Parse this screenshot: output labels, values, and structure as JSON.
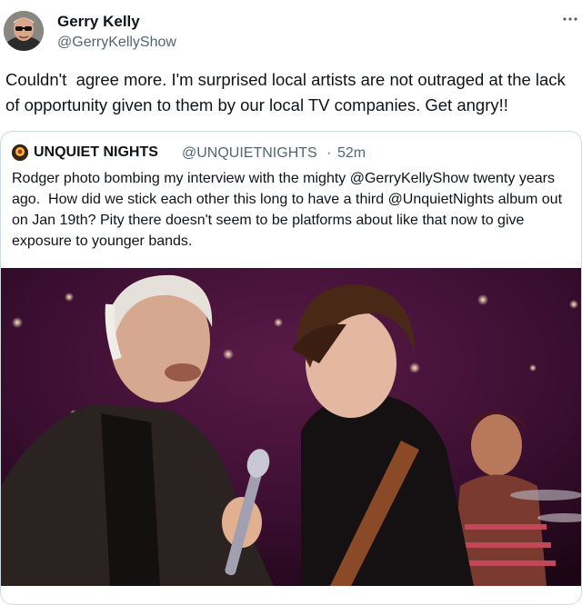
{
  "author": {
    "display_name": "Gerry Kelly",
    "handle": "@GerryKellyShow"
  },
  "tweet": {
    "text": "Couldn't  agree more. I'm surprised local artists are not outraged at the lack of opportunity given to them by our local TV companies. Get angry!!",
    "more_icon": "more-horizontal-icon"
  },
  "quoted_tweet": {
    "display_name": "UNQUIET NIGHTS",
    "handle": "@UNQUIETNIGHTS",
    "separator": "·",
    "time": "52m",
    "text": "Rodger photo bombing my interview with the mighty @GerryKellyShow twenty years ago.  How did we stick each other this long to have a third @UnquietNights album out on Jan 19th? Pity there doesn't seem to be platforms about like that now to give exposure to younger bands."
  },
  "colors": {
    "text": "#0f1419",
    "secondary": "#536471",
    "border": "#cfd9de",
    "photo_background": "#3a1030"
  }
}
